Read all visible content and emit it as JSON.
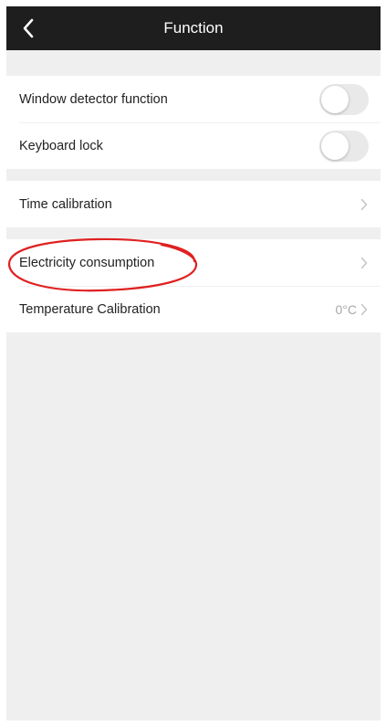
{
  "header": {
    "title": "Function",
    "back_icon": "chevron-left-icon"
  },
  "groups": [
    {
      "items": [
        {
          "label": "Window detector function",
          "control": "toggle",
          "on": false
        },
        {
          "label": "Keyboard lock",
          "control": "toggle",
          "on": false
        }
      ]
    },
    {
      "items": [
        {
          "label": "Time calibration",
          "control": "chevron"
        }
      ]
    },
    {
      "items": [
        {
          "label": "Electricity consumption",
          "control": "chevron"
        },
        {
          "label": "Temperature Calibration",
          "control": "chevron",
          "value": "0°C"
        }
      ]
    }
  ],
  "colors": {
    "nav_background": "#1e1e1e",
    "page_background": "#efefef",
    "annotation": "#e02020",
    "toggle_off": "#e9e9ea"
  }
}
